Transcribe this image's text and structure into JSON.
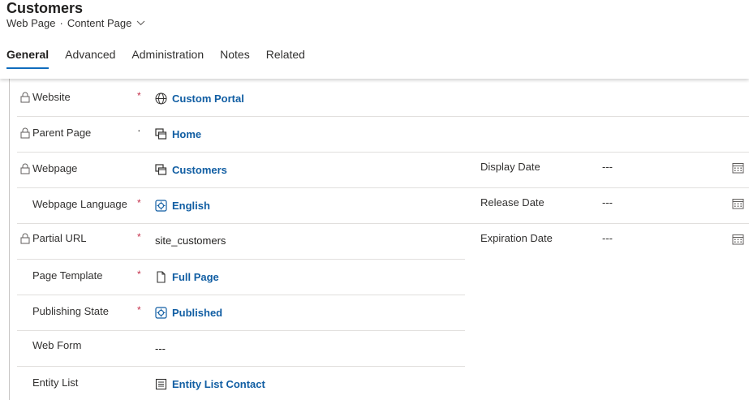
{
  "header": {
    "title": "Customers",
    "entity": "Web Page",
    "separator": "·",
    "form": "Content Page"
  },
  "tabs": [
    {
      "label": "General",
      "active": true
    },
    {
      "label": "Advanced",
      "active": false
    },
    {
      "label": "Administration",
      "active": false
    },
    {
      "label": "Notes",
      "active": false
    },
    {
      "label": "Related",
      "active": false
    }
  ],
  "fields": {
    "website": {
      "label": "Website",
      "required": "*",
      "value": "Custom Portal",
      "icon": "globe-icon"
    },
    "parent_page": {
      "label": "Parent Page",
      "required": "·",
      "value": "Home",
      "icon": "webpage-icon"
    },
    "webpage": {
      "label": "Webpage",
      "value": "Customers",
      "icon": "webpage-icon"
    },
    "webpage_language": {
      "label": "Webpage Language",
      "required": "*",
      "value": "English",
      "icon": "entity-icon"
    },
    "partial_url": {
      "label": "Partial URL",
      "required": "*",
      "value": "site_customers"
    },
    "page_template": {
      "label": "Page Template",
      "required": "*",
      "value": "Full Page",
      "icon": "document-icon"
    },
    "publishing_state": {
      "label": "Publishing State",
      "required": "*",
      "value": "Published",
      "icon": "entity-icon"
    },
    "web_form": {
      "label": "Web Form",
      "value": "---"
    },
    "entity_list": {
      "label": "Entity List",
      "value": "Entity List Contact",
      "icon": "list-icon"
    }
  },
  "dates": {
    "display_date": {
      "label": "Display Date",
      "value": "---"
    },
    "release_date": {
      "label": "Release Date",
      "value": "---"
    },
    "expiration_date": {
      "label": "Expiration Date",
      "value": "---"
    }
  },
  "colors": {
    "accent": "#0f6cbd",
    "link": "#115ea3",
    "required": "#c4314b",
    "divider": "#e1dfdd"
  }
}
